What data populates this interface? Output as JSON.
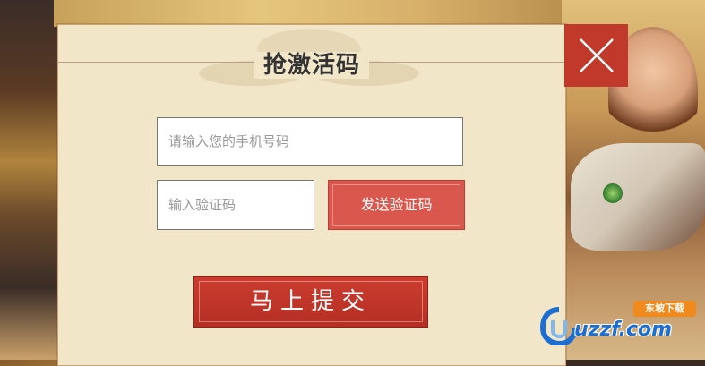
{
  "dialog": {
    "title": "抢激活码",
    "phone_placeholder": "请输入您的手机号码",
    "code_placeholder": "输入验证码",
    "send_code_label": "发送验证码",
    "submit_label": "马上提交"
  },
  "watermark": {
    "site": "uzzf.com",
    "badge": "东坡下载"
  },
  "colors": {
    "accent_red": "#c0392b",
    "dialog_bg": "#f1e6c8"
  }
}
